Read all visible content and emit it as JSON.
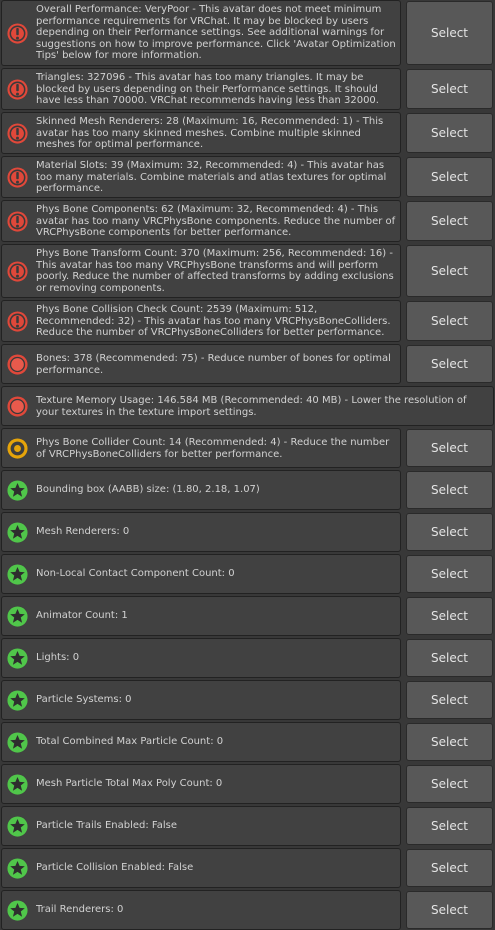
{
  "select_label": "Select",
  "colors": {
    "background": "#383838",
    "row_background": "#414141",
    "button_background": "#585858",
    "icon_error": "#e0483a",
    "icon_warning": "#e6a40a",
    "icon_ok": "#50c64a"
  },
  "items": [
    {
      "status": "error-exclamation",
      "icon": "error-exclamation-icon",
      "has_select": true,
      "text": "Overall Performance: VeryPoor - This avatar does not meet minimum performance requirements for VRChat. It may be blocked by users depending on their Performance settings. See additional warnings for suggestions on how to improve performance. Click 'Avatar Optimization Tips' below for more information."
    },
    {
      "status": "error-exclamation",
      "icon": "error-exclamation-icon",
      "has_select": true,
      "text": "Triangles: 327096 - This avatar has too many triangles. It may be blocked by users depending on their Performance settings. It should have less than 70000. VRChat recommends having less than 32000."
    },
    {
      "status": "error-exclamation",
      "icon": "error-exclamation-icon",
      "has_select": true,
      "text": "Skinned Mesh Renderers: 28 (Maximum: 16, Recommended: 1) - This avatar has too many skinned meshes. Combine multiple skinned meshes for optimal performance."
    },
    {
      "status": "error-exclamation",
      "icon": "error-exclamation-icon",
      "has_select": true,
      "text": "Material Slots: 39 (Maximum: 32, Recommended: 4) - This avatar has too many materials. Combine materials and atlas textures for optimal performance."
    },
    {
      "status": "error-exclamation",
      "icon": "error-exclamation-icon",
      "has_select": true,
      "text": "Phys Bone Components: 62 (Maximum: 32, Recommended: 4) - This avatar has too many VRCPhysBone components. Reduce the number of VRCPhysBone components for better performance."
    },
    {
      "status": "error-exclamation",
      "icon": "error-exclamation-icon",
      "has_select": true,
      "text": "Phys Bone Transform Count: 370 (Maximum: 256, Recommended: 16) - This avatar has too many VRCPhysBone transforms and will perform poorly. Reduce the number of affected transforms by adding exclusions or removing components."
    },
    {
      "status": "error-exclamation",
      "icon": "error-exclamation-icon",
      "has_select": true,
      "text": "Phys Bone Collision Check Count: 2539 (Maximum: 512, Recommended: 32) - This avatar has too many VRCPhysBoneColliders. Reduce the number of VRCPhysBoneColliders for better performance."
    },
    {
      "status": "error-solid",
      "icon": "red-circle-icon",
      "has_select": true,
      "text": "Bones: 378 (Recommended: 75) - Reduce number of bones for optimal performance."
    },
    {
      "status": "error-solid",
      "icon": "red-circle-icon",
      "has_select": false,
      "text": "Texture Memory Usage: 146.584 MB (Recommended: 40 MB) - Lower the resolution of your textures in the texture import settings."
    },
    {
      "status": "warning",
      "icon": "yellow-ring-icon",
      "has_select": true,
      "text": "Phys Bone Collider Count: 14 (Recommended: 4) - Reduce the number of VRCPhysBoneColliders for better performance."
    },
    {
      "status": "ok",
      "icon": "green-star-icon",
      "has_select": true,
      "text": "Bounding box (AABB) size: (1.80, 2.18, 1.07)"
    },
    {
      "status": "ok",
      "icon": "green-star-icon",
      "has_select": true,
      "text": "Mesh Renderers: 0"
    },
    {
      "status": "ok",
      "icon": "green-star-icon",
      "has_select": true,
      "text": "Non-Local Contact Component Count: 0"
    },
    {
      "status": "ok",
      "icon": "green-star-icon",
      "has_select": true,
      "text": "Animator Count: 1"
    },
    {
      "status": "ok",
      "icon": "green-star-icon",
      "has_select": true,
      "text": "Lights: 0"
    },
    {
      "status": "ok",
      "icon": "green-star-icon",
      "has_select": true,
      "text": "Particle Systems: 0"
    },
    {
      "status": "ok",
      "icon": "green-star-icon",
      "has_select": true,
      "text": "Total Combined Max Particle Count: 0"
    },
    {
      "status": "ok",
      "icon": "green-star-icon",
      "has_select": true,
      "text": "Mesh Particle Total Max Poly Count: 0"
    },
    {
      "status": "ok",
      "icon": "green-star-icon",
      "has_select": true,
      "text": "Particle Trails Enabled: False"
    },
    {
      "status": "ok",
      "icon": "green-star-icon",
      "has_select": true,
      "text": "Particle Collision Enabled: False"
    },
    {
      "status": "ok",
      "icon": "green-star-icon",
      "has_select": true,
      "text": "Trail Renderers: 0"
    }
  ]
}
